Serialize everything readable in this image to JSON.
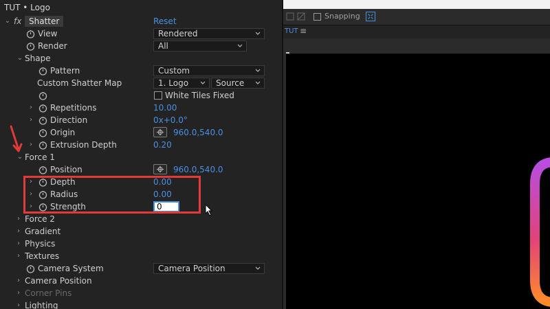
{
  "panel": {
    "title": "TUT • Logo"
  },
  "effect": {
    "fx": "fx",
    "name": "Shatter",
    "reset": "Reset"
  },
  "rows": {
    "view": {
      "label": "View",
      "value": "Rendered"
    },
    "render": {
      "label": "Render",
      "value": "All"
    },
    "shape": {
      "label": "Shape"
    },
    "pattern": {
      "label": "Pattern",
      "value": "Custom"
    },
    "custom_map": {
      "label": "Custom Shatter Map",
      "layer": "1. Logo",
      "source": "Source"
    },
    "white_tiles": {
      "label": "White Tiles Fixed"
    },
    "repetitions": {
      "label": "Repetitions",
      "value": "10.00"
    },
    "direction": {
      "label": "Direction",
      "value": "0x+0.0°"
    },
    "origin": {
      "label": "Origin",
      "value": "960.0,540.0"
    },
    "extrusion": {
      "label": "Extrusion Depth",
      "value": "0.20"
    },
    "force1": {
      "label": "Force 1"
    },
    "position": {
      "label": "Position",
      "value": "960.0,540.0"
    },
    "depth": {
      "label": "Depth",
      "value": "0.00"
    },
    "radius": {
      "label": "Radius",
      "value": "0.00"
    },
    "strength": {
      "label": "Strength",
      "value": "0"
    },
    "force2": {
      "label": "Force 2"
    },
    "gradient": {
      "label": "Gradient"
    },
    "physics": {
      "label": "Physics"
    },
    "textures": {
      "label": "Textures"
    },
    "camera_system": {
      "label": "Camera System",
      "value": "Camera Position"
    },
    "camera_position": {
      "label": "Camera Position"
    },
    "corner_pins": {
      "label": "Corner Pins"
    },
    "lighting": {
      "label": "Lighting"
    }
  },
  "viewer": {
    "snapping": "Snapping",
    "tab": "TUT"
  },
  "colors": {
    "accent": "#4a90e2",
    "highlight": "#e23a3a",
    "logo_top": "#b84de0",
    "logo_bottom": "#ff8a2a"
  }
}
